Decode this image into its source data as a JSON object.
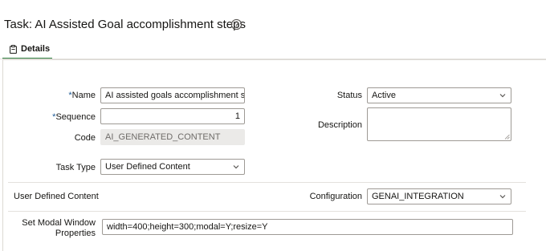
{
  "header": {
    "title": "Task: AI Assisted Goal accomplishment steps",
    "help_icon": "question-circle-icon"
  },
  "tabs": [
    {
      "label": "Details",
      "icon": "clipboard-icon",
      "selected": true
    }
  ],
  "form": {
    "name": {
      "required_mark": "*",
      "label": "Name",
      "value": "AI assisted goals accomplishment steps"
    },
    "sequence": {
      "required_mark": "*",
      "label": "Sequence",
      "value": "1"
    },
    "code": {
      "label": "Code",
      "value": "AI_GENERATED_CONTENT"
    },
    "task_type": {
      "label": "Task Type",
      "value": "User Defined Content"
    },
    "status": {
      "label": "Status",
      "value": "Active"
    },
    "description": {
      "label": "Description",
      "value": ""
    },
    "user_defined_content": {
      "label": "User Defined Content"
    },
    "configuration": {
      "label": "Configuration",
      "value": "GENAI_INTEGRATION"
    },
    "modal_props": {
      "label_line1": "Set Modal Window",
      "label_line2": "Properties",
      "value": "width=400;height=300;modal=Y;resize=Y"
    }
  },
  "colors": {
    "required": "#1e5a96",
    "tab_underline": "#2b7a3b",
    "readonly_bg": "#ebeae8"
  }
}
